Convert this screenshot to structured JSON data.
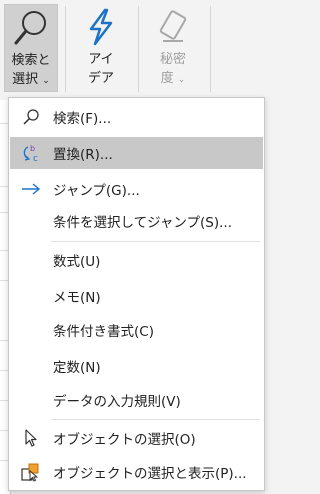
{
  "ribbon": {
    "search": {
      "line1": "検索と",
      "line2": "選択",
      "caret": "⌄"
    },
    "ideas": {
      "line1": "アイ",
      "line2": "デア"
    },
    "sensitivity": {
      "line1": "秘密",
      "line2": "度",
      "caret": "⌄"
    }
  },
  "menu": {
    "items": [
      {
        "label": "検索(F)...",
        "icon": "search-icon"
      },
      {
        "label": "置換(R)...",
        "icon": "replace-icon",
        "highlighted": true
      },
      {
        "label": "ジャンプ(G)...",
        "icon": "arrow-right-icon"
      },
      {
        "label": "条件を選択してジャンプ(S)..."
      },
      {
        "label": "数式(U)"
      },
      {
        "label": "メモ(N)"
      },
      {
        "label": "条件付き書式(C)"
      },
      {
        "label": "定数(N)"
      },
      {
        "label": "データの入力規則(V)"
      },
      {
        "label": "オブジェクトの選択(O)",
        "icon": "pointer-icon"
      },
      {
        "label": "オブジェクトの選択と表示(P)...",
        "icon": "selection-pane-icon"
      }
    ]
  },
  "colors": {
    "accent": "#1e73c8",
    "hover": "#c8c8c8",
    "disabled": "#a0a0a0"
  }
}
